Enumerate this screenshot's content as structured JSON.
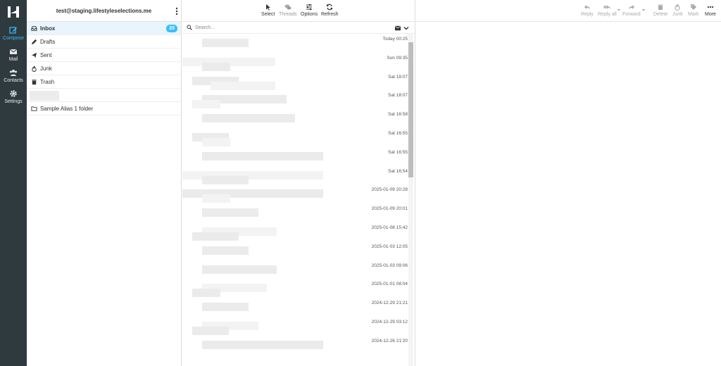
{
  "rail": {
    "items": [
      {
        "label": "Compose",
        "icon": "compose-icon",
        "active": true
      },
      {
        "label": "Mail",
        "icon": "mail-icon",
        "active": false
      },
      {
        "label": "Contacts",
        "icon": "contacts-icon",
        "active": false
      },
      {
        "label": "Settings",
        "icon": "gear-icon",
        "active": false
      }
    ],
    "colors": {
      "bg": "#2f3a3f",
      "accent": "#37beff"
    }
  },
  "folders": {
    "account": "test@staging.lifestyleselections.me",
    "inbox": {
      "label": "Inbox",
      "count": "20"
    },
    "drafts": {
      "label": "Drafts"
    },
    "sent": {
      "label": "Sent"
    },
    "junk": {
      "label": "Junk"
    },
    "trash": {
      "label": "Trash"
    },
    "alias": {
      "label": "Sample Alias 1 folder"
    }
  },
  "list_toolbar": {
    "select": "Select",
    "threads": "Threads",
    "options": "Options",
    "refresh": "Refresh"
  },
  "search": {
    "placeholder": "Search..."
  },
  "messages": [
    "Today 00:25",
    "Sun 09:35",
    "Sat 18:07",
    "Sat 18:07",
    "Sat 16:58",
    "Sat 16:55",
    "Sat 16:55",
    "Sat 16:54",
    "2025-01-09 20:28",
    "2025-01-09 20:01",
    "2025-01-08 15:42",
    "2025-01-03 12:05",
    "2025-01-03 09:06",
    "2025-01-01 08:04",
    "2024-12-29 21:21",
    "2024-12-29 03:12",
    "2024-12-26 21:20"
  ],
  "preview_toolbar": {
    "reply": "Reply",
    "reply_all": "Reply all",
    "forward": "Forward",
    "delete": "Delete",
    "junk": "Junk",
    "mark": "Mark",
    "more": "More"
  }
}
